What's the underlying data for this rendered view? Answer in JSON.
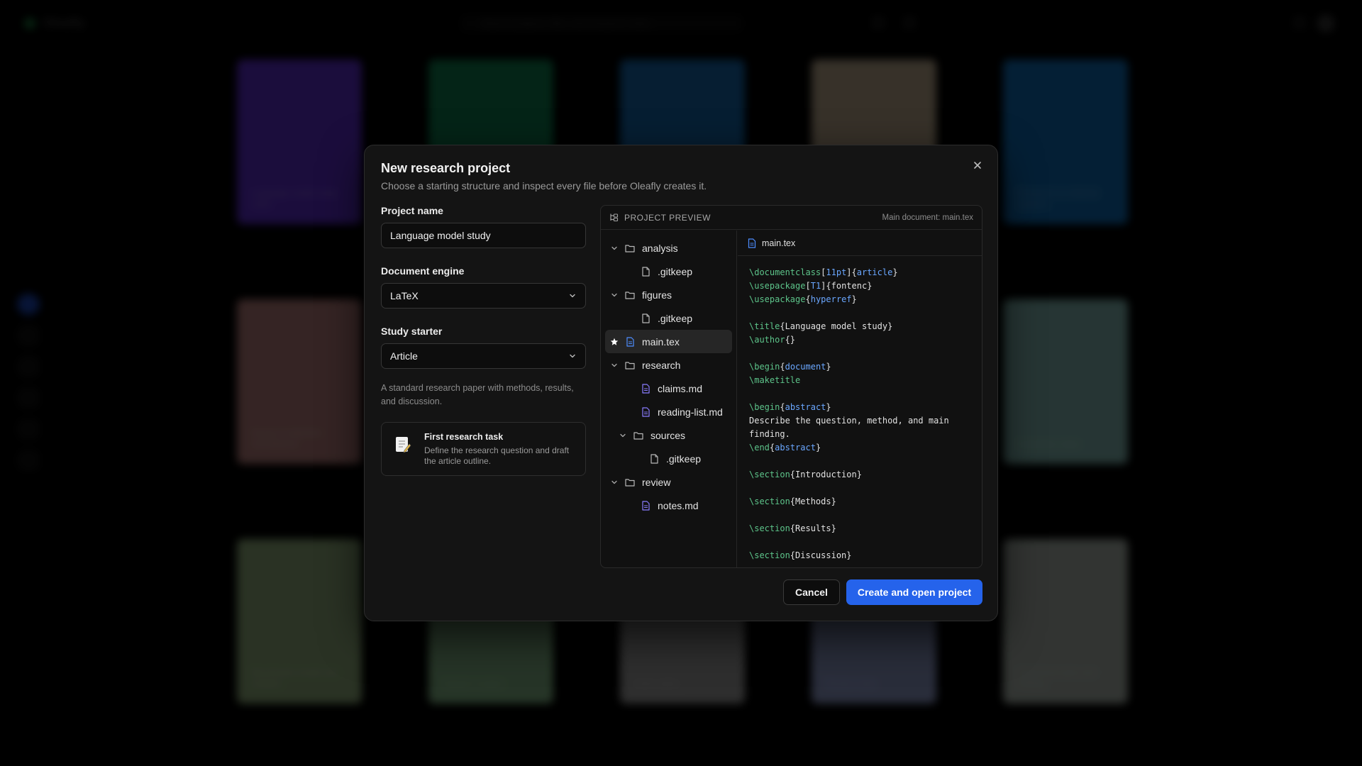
{
  "background": {
    "app_name": "Oleafly",
    "search_placeholder": "Search projects, files, and research notes",
    "cards": [
      {
        "color": "#5b2dc9",
        "title": "Language model study notes"
      },
      {
        "color": "#0f7a4d",
        "title": ""
      },
      {
        "color": "#1565a8",
        "title": ""
      },
      {
        "color": "#b7a58a",
        "title": ""
      },
      {
        "color": "#116bb3",
        "title": "Research on retrieval systems"
      },
      {
        "color": "#b17a78",
        "title": "Survey of attention mechanisms"
      },
      {
        "color": "#7fb3ad",
        "title": "Evaluation notes"
      },
      {
        "color": "#8ca878",
        "title": "Benchmark results and analysis"
      },
      {
        "color": "#7fb082",
        "title": "Dataset curation"
      },
      {
        "color": "#9a9a9a",
        "title": "Draft outline"
      },
      {
        "color": "#8b97c4",
        "title": "Review notes"
      },
      {
        "color": "#a7b0a8",
        "title": "Experiment plan and findings"
      }
    ]
  },
  "dialog": {
    "title": "New research project",
    "subtitle": "Choose a starting structure and inspect every file before Oleafly creates it.",
    "close_icon": "close-icon",
    "project_name": {
      "label": "Project name",
      "value": "Language model study"
    },
    "document_engine": {
      "label": "Document engine",
      "value": "LaTeX"
    },
    "study_starter": {
      "label": "Study starter",
      "value": "Article",
      "description": "A standard research paper with methods, results, and discussion."
    },
    "task": {
      "title": "First research task",
      "description": "Define the research question and draft the article outline."
    },
    "preview": {
      "header": "PROJECT PREVIEW",
      "main_document": "Main document: main.tex",
      "tree": [
        {
          "label": "analysis",
          "type": "folder",
          "depth": 0
        },
        {
          "label": ".gitkeep",
          "type": "file",
          "depth": 1
        },
        {
          "label": "figures",
          "type": "folder",
          "depth": 0
        },
        {
          "label": ".gitkeep",
          "type": "file",
          "depth": 1
        },
        {
          "label": "main.tex",
          "type": "main",
          "depth": 0
        },
        {
          "label": "research",
          "type": "folder",
          "depth": 0
        },
        {
          "label": "claims.md",
          "type": "doc",
          "depth": 1
        },
        {
          "label": "reading-list.md",
          "type": "doc",
          "depth": 1
        },
        {
          "label": "sources",
          "type": "folder",
          "depth": 1
        },
        {
          "label": ".gitkeep",
          "type": "file",
          "depth": 2
        },
        {
          "label": "review",
          "type": "folder",
          "depth": 0
        },
        {
          "label": "notes.md",
          "type": "doc",
          "depth": 1
        }
      ],
      "open_file": "main.tex",
      "code_lines": [
        [
          [
            "cmd",
            "\\documentclass"
          ],
          [
            "txt",
            "["
          ],
          [
            "arg",
            "11pt"
          ],
          [
            "txt",
            "]{"
          ],
          [
            "arg",
            "article"
          ],
          [
            "txt",
            "}"
          ]
        ],
        [
          [
            "cmd",
            "\\usepackage"
          ],
          [
            "txt",
            "["
          ],
          [
            "arg",
            "T1"
          ],
          [
            "txt",
            "]{fontenc}"
          ]
        ],
        [
          [
            "cmd",
            "\\usepackage"
          ],
          [
            "txt",
            "{"
          ],
          [
            "arg",
            "hyperref"
          ],
          [
            "txt",
            "}"
          ]
        ],
        [],
        [
          [
            "cmd",
            "\\title"
          ],
          [
            "txt",
            "{Language model study}"
          ]
        ],
        [
          [
            "cmd",
            "\\author"
          ],
          [
            "txt",
            "{}"
          ]
        ],
        [],
        [
          [
            "cmd",
            "\\begin"
          ],
          [
            "txt",
            "{"
          ],
          [
            "arg",
            "document"
          ],
          [
            "txt",
            "}"
          ]
        ],
        [
          [
            "cmd",
            "\\maketitle"
          ]
        ],
        [],
        [
          [
            "cmd",
            "\\begin"
          ],
          [
            "txt",
            "{"
          ],
          [
            "arg",
            "abstract"
          ],
          [
            "txt",
            "}"
          ]
        ],
        [
          [
            "txt",
            "Describe the question, method, and main"
          ]
        ],
        [
          [
            "txt",
            "finding."
          ]
        ],
        [
          [
            "cmd",
            "\\end"
          ],
          [
            "txt",
            "{"
          ],
          [
            "arg",
            "abstract"
          ],
          [
            "txt",
            "}"
          ]
        ],
        [],
        [
          [
            "cmd",
            "\\section"
          ],
          [
            "txt",
            "{Introduction}"
          ]
        ],
        [],
        [
          [
            "cmd",
            "\\section"
          ],
          [
            "txt",
            "{Methods}"
          ]
        ],
        [],
        [
          [
            "cmd",
            "\\section"
          ],
          [
            "txt",
            "{Results}"
          ]
        ],
        [],
        [
          [
            "cmd",
            "\\section"
          ],
          [
            "txt",
            "{Discussion}"
          ]
        ]
      ]
    },
    "buttons": {
      "cancel": "Cancel",
      "create": "Create and open project"
    }
  }
}
